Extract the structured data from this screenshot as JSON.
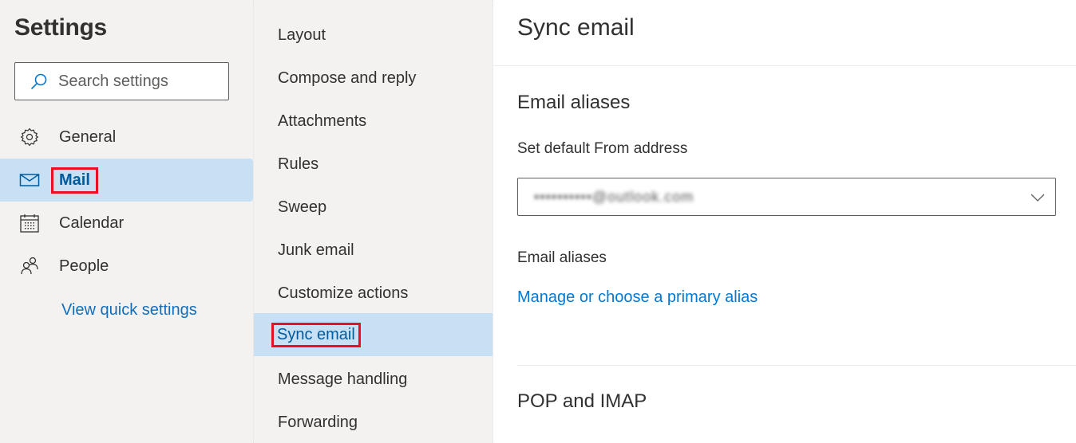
{
  "sidebar": {
    "title": "Settings",
    "search": {
      "placeholder": "Search settings",
      "value": ""
    },
    "items": [
      {
        "label": "General",
        "icon": "gear-icon",
        "selected": false
      },
      {
        "label": "Mail",
        "icon": "mail-icon",
        "selected": true,
        "highlighted": true
      },
      {
        "label": "Calendar",
        "icon": "calendar-icon",
        "selected": false
      },
      {
        "label": "People",
        "icon": "people-icon",
        "selected": false
      }
    ],
    "quick_settings_link": "View quick settings"
  },
  "subnav": {
    "items": [
      {
        "label": "Layout",
        "selected": false
      },
      {
        "label": "Compose and reply",
        "selected": false
      },
      {
        "label": "Attachments",
        "selected": false
      },
      {
        "label": "Rules",
        "selected": false
      },
      {
        "label": "Sweep",
        "selected": false
      },
      {
        "label": "Junk email",
        "selected": false
      },
      {
        "label": "Customize actions",
        "selected": false
      },
      {
        "label": "Sync email",
        "selected": true,
        "highlighted": true
      },
      {
        "label": "Message handling",
        "selected": false
      },
      {
        "label": "Forwarding",
        "selected": false
      }
    ]
  },
  "main": {
    "title": "Sync email",
    "email_aliases_section": {
      "heading": "Email aliases",
      "default_from_label": "Set default From address",
      "default_from_value": "••••••••••@outlook.com",
      "aliases_label": "Email aliases",
      "manage_link": "Manage or choose a primary alias"
    },
    "pop_imap_section": {
      "heading": "POP and IMAP"
    }
  },
  "colors": {
    "selected_bg": "#c7e0f4",
    "selected_text": "#005a9e",
    "link": "#0078d4",
    "highlight_border": "#e81123",
    "pane_bg": "#f3f2f1"
  }
}
